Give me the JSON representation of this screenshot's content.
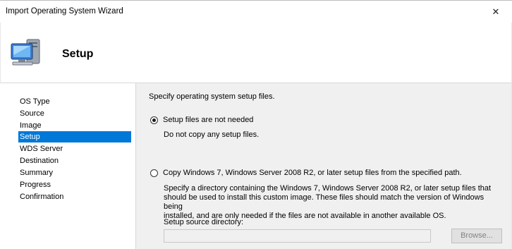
{
  "window": {
    "title": "Import Operating System Wizard",
    "close_glyph": "✕"
  },
  "header": {
    "heading": "Setup",
    "icon": "computer-icon"
  },
  "sidebar": {
    "items": [
      {
        "label": "OS Type",
        "selected": false
      },
      {
        "label": "Source",
        "selected": false
      },
      {
        "label": "Image",
        "selected": false
      },
      {
        "label": "Setup",
        "selected": true
      },
      {
        "label": "WDS Server",
        "selected": false
      },
      {
        "label": "Destination",
        "selected": false
      },
      {
        "label": "Summary",
        "selected": false
      },
      {
        "label": "Progress",
        "selected": false
      },
      {
        "label": "Confirmation",
        "selected": false
      }
    ]
  },
  "content": {
    "instruction": "Specify operating system setup files.",
    "option1": {
      "label": "Setup files are not needed",
      "description": "Do not copy any setup files.",
      "checked": true
    },
    "option2": {
      "label": "Copy Windows 7, Windows Server 2008 R2, or later setup files from the specified path.",
      "description_line1": "Specify a directory containing the Windows 7, Windows Server 2008 R2, or later setup files that",
      "description_line2": "should be used to install this custom image.  These files should match the version of Windows being",
      "description_line3": "installed, and are only needed if the files are not available in another available OS.",
      "checked": false
    },
    "source_dir_label": "Setup source directory:",
    "source_dir_value": "",
    "browse_label": "Browse..."
  },
  "colors": {
    "selection": "#0078d7",
    "panel": "#f0f0f0"
  }
}
